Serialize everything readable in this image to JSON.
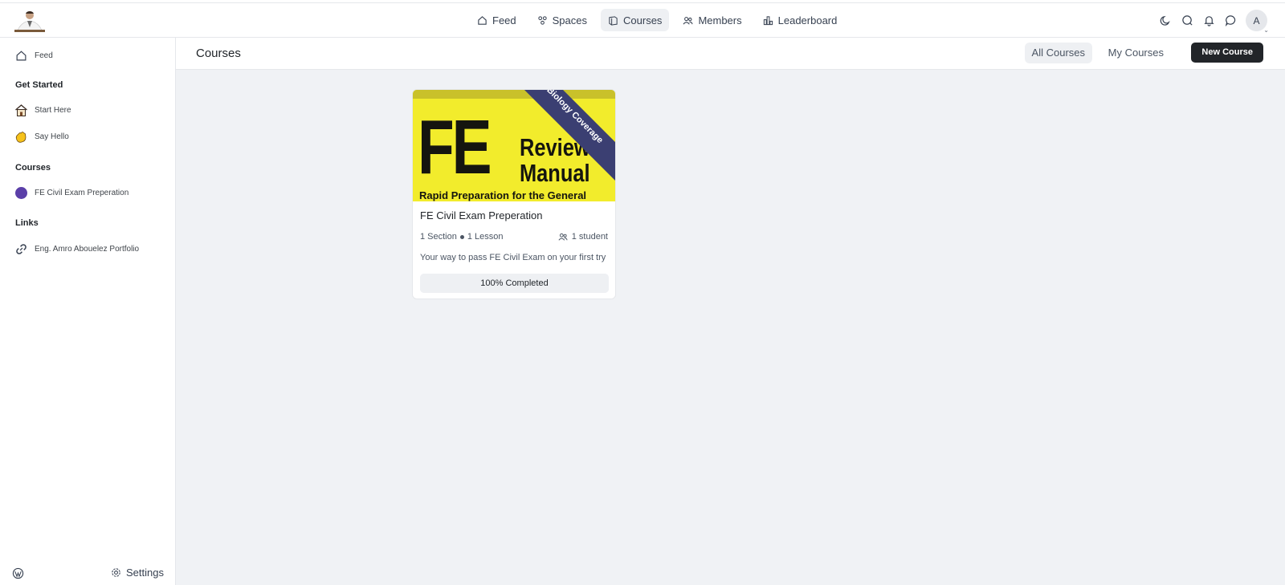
{
  "nav": {
    "items": [
      {
        "label": "Feed",
        "icon": "home-icon"
      },
      {
        "label": "Spaces",
        "icon": "spaces-icon"
      },
      {
        "label": "Courses",
        "icon": "courses-icon",
        "active": true
      },
      {
        "label": "Members",
        "icon": "members-icon"
      },
      {
        "label": "Leaderboard",
        "icon": "leaderboard-icon"
      }
    ],
    "avatar_initial": "A"
  },
  "sidebar": {
    "feed_label": "Feed",
    "sections": {
      "get_started": "Get Started",
      "courses": "Courses",
      "links": "Links"
    },
    "get_started_items": [
      {
        "label": "Start Here",
        "icon": "house-emoji-icon"
      },
      {
        "label": "Say Hello",
        "icon": "waving-hand-emoji-icon"
      }
    ],
    "course_items": [
      {
        "label": "FE Civil Exam Preperation",
        "icon": "purple-circle-icon"
      }
    ],
    "link_items": [
      {
        "label": "Eng. Amro Abouelez Portfolio",
        "icon": "link-icon"
      }
    ],
    "settings_label": "Settings"
  },
  "page": {
    "title": "Courses",
    "tabs": {
      "all": "All Courses",
      "mine": "My Courses"
    },
    "new_course": "New Course"
  },
  "course_card": {
    "cover": {
      "big_text": "FE",
      "review": "Review",
      "manual": "Manual",
      "subtitle": "Rapid Preparation for the General",
      "band": "Biology Coverage"
    },
    "title": "FE Civil Exam Preperation",
    "sections": "1 Section",
    "lessons": "1 Lesson",
    "students": "1 student",
    "description": "Your way to pass FE Civil Exam on your first try",
    "progress_label": "100% Completed",
    "progress_value": 1.0
  },
  "colors": {
    "accent_dark": "#222529",
    "page_bg": "#f0f2f5",
    "active_bg": "#eef0f3",
    "cover_yellow": "#f2ec2c",
    "cover_band": "#3b3f72",
    "course_dot": "#5b3fa8"
  }
}
